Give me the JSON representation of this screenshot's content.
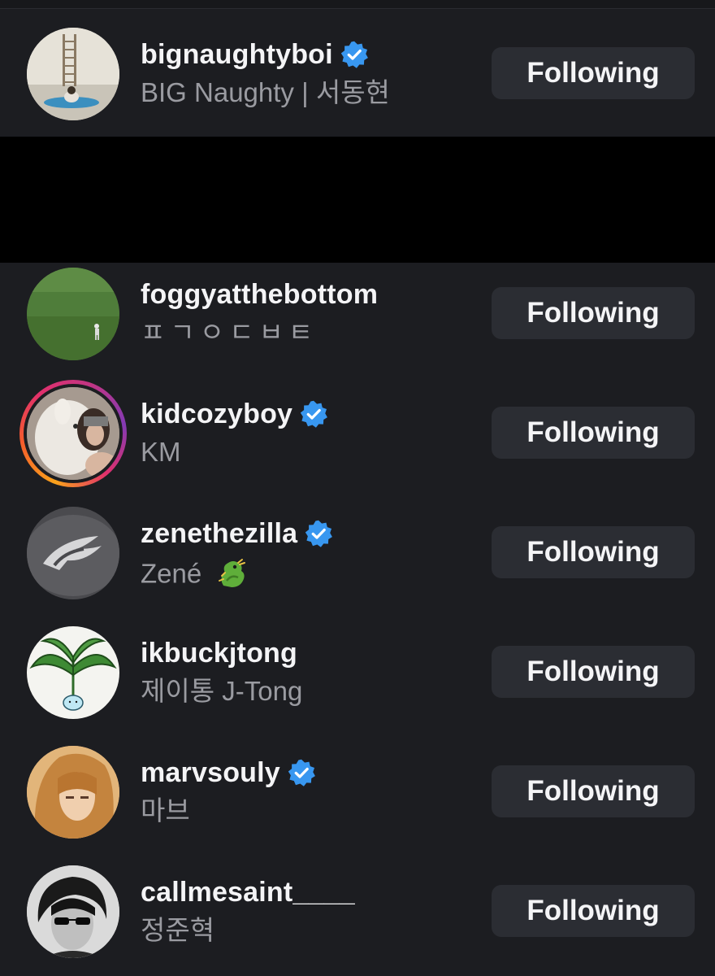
{
  "following_list": [
    {
      "username": "bignaughtyboi",
      "full_name": "BIG Naughty | 서동현",
      "verified": true,
      "button_label": "Following",
      "avatar": "room-with-ladder-photo"
    },
    {
      "username": "foggyatthebottom",
      "full_name": "ㅍㄱㅇㄷㅂㅌ",
      "verified": false,
      "button_label": "Following",
      "avatar": "green-field-photo"
    },
    {
      "username": "kidcozyboy",
      "full_name": "KM",
      "verified": true,
      "has_story": true,
      "button_label": "Following",
      "avatar": "person-with-alpaca-photo"
    },
    {
      "username": "zenethezilla",
      "full_name": "Zené",
      "full_name_emoji": "dragon-emoji",
      "verified": true,
      "button_label": "Following",
      "avatar": "embroidered-logo-photo"
    },
    {
      "username": "ikbuckjtong",
      "full_name": "제이통 J-Tong",
      "verified": false,
      "button_label": "Following",
      "avatar": "plant-illustration"
    },
    {
      "username": "marvsouly",
      "full_name": "마브",
      "verified": true,
      "button_label": "Following",
      "avatar": "portrait-orange-hair-photo"
    },
    {
      "username": "callmesaint____",
      "full_name": "정준혁",
      "verified": false,
      "button_label": "Following",
      "avatar": "portrait-sunglasses-photo"
    }
  ],
  "colors": {
    "background": "#1c1d21",
    "button_bg": "#2b2d33",
    "verified_blue": "#3897f0",
    "secondary_text": "#9a9ba1"
  }
}
